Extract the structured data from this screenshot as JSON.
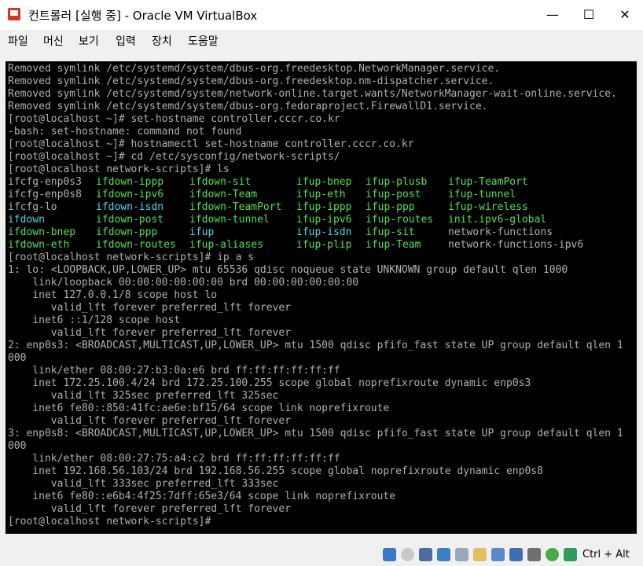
{
  "window": {
    "title": "컨트롤러 [실행 중] - Oracle VM VirtualBox",
    "minimize": "—",
    "maximize": "☐",
    "close": "✕"
  },
  "menu": [
    "파일",
    "머신",
    "보기",
    "입력",
    "장치",
    "도움말"
  ],
  "terminal": {
    "lines_before": [
      "Removed symlink /etc/systemd/system/dbus-org.freedesktop.NetworkManager.service.",
      "Removed symlink /etc/systemd/system/dbus-org.freedesktop.nm-dispatcher.service.",
      "Removed symlink /etc/systemd/system/network-online.target.wants/NetworkManager-wait-online.service.",
      "Removed symlink /etc/systemd/system/dbus-org.fedoraproject.FirewallD1.service.",
      "[root@localhost ~]# set-hostname controller.cccr.co.kr",
      "-bash: set-hostname: command not found",
      "[root@localhost ~]# hostnamectl set-hostname controller.cccr.co.kr",
      "[root@localhost ~]# cd /etc/sysconfig/network-scripts/",
      "[root@localhost network-scripts]# ls"
    ],
    "ls_rows": [
      [
        {
          "t": "ifcfg-enp0s3",
          "c": "gray"
        },
        {
          "t": "ifdown-ippp",
          "c": "green"
        },
        {
          "t": "ifdown-sit",
          "c": "green"
        },
        {
          "t": "ifup-bnep",
          "c": "green"
        },
        {
          "t": "ifup-plusb",
          "c": "green"
        },
        {
          "t": "ifup-TeamPort",
          "c": "green"
        }
      ],
      [
        {
          "t": "ifcfg-enp0s8",
          "c": "gray"
        },
        {
          "t": "ifdown-ipv6",
          "c": "green"
        },
        {
          "t": "ifdown-Team",
          "c": "green"
        },
        {
          "t": "ifup-eth",
          "c": "green"
        },
        {
          "t": "ifup-post",
          "c": "green"
        },
        {
          "t": "ifup-tunnel",
          "c": "green"
        }
      ],
      [
        {
          "t": "ifcfg-lo",
          "c": "gray"
        },
        {
          "t": "ifdown-isdn",
          "c": "cyan"
        },
        {
          "t": "ifdown-TeamPort",
          "c": "green"
        },
        {
          "t": "ifup-ippp",
          "c": "green"
        },
        {
          "t": "ifup-ppp",
          "c": "green"
        },
        {
          "t": "ifup-wireless",
          "c": "green"
        }
      ],
      [
        {
          "t": "ifdown",
          "c": "cyan"
        },
        {
          "t": "ifdown-post",
          "c": "green"
        },
        {
          "t": "ifdown-tunnel",
          "c": "green"
        },
        {
          "t": "ifup-ipv6",
          "c": "green"
        },
        {
          "t": "ifup-routes",
          "c": "green"
        },
        {
          "t": "init.ipv6-global",
          "c": "green"
        }
      ],
      [
        {
          "t": "ifdown-bnep",
          "c": "green"
        },
        {
          "t": "ifdown-ppp",
          "c": "green"
        },
        {
          "t": "ifup",
          "c": "cyan"
        },
        {
          "t": "ifup-isdn",
          "c": "cyan"
        },
        {
          "t": "ifup-sit",
          "c": "green"
        },
        {
          "t": "network-functions",
          "c": "gray"
        }
      ],
      [
        {
          "t": "ifdown-eth",
          "c": "green"
        },
        {
          "t": "ifdown-routes",
          "c": "green"
        },
        {
          "t": "ifup-aliases",
          "c": "green"
        },
        {
          "t": "ifup-plip",
          "c": "green"
        },
        {
          "t": "ifup-Team",
          "c": "green"
        },
        {
          "t": "network-functions-ipv6",
          "c": "gray"
        }
      ]
    ],
    "lines_after": [
      "[root@localhost network-scripts]# ip a s",
      "1: lo: <LOOPBACK,UP,LOWER_UP> mtu 65536 qdisc noqueue state UNKNOWN group default qlen 1000",
      "    link/loopback 00:00:00:00:00:00 brd 00:00:00:00:00:00",
      "    inet 127.0.0.1/8 scope host lo",
      "       valid_lft forever preferred_lft forever",
      "    inet6 ::1/128 scope host",
      "       valid_lft forever preferred_lft forever",
      "2: enp0s3: <BROADCAST,MULTICAST,UP,LOWER_UP> mtu 1500 qdisc pfifo_fast state UP group default qlen 1",
      "000",
      "    link/ether 08:00:27:b3:0a:e6 brd ff:ff:ff:ff:ff:ff",
      "    inet 172.25.100.4/24 brd 172.25.100.255 scope global noprefixroute dynamic enp0s3",
      "       valid_lft 325sec preferred_lft 325sec",
      "    inet6 fe80::850:41fc:ae6e:bf15/64 scope link noprefixroute",
      "       valid_lft forever preferred_lft forever",
      "3: enp0s8: <BROADCAST,MULTICAST,UP,LOWER_UP> mtu 1500 qdisc pfifo_fast state UP group default qlen 1",
      "000",
      "    link/ether 08:00:27:75:a4:c2 brd ff:ff:ff:ff:ff:ff",
      "    inet 192.168.56.103/24 brd 192.168.56.255 scope global noprefixroute dynamic enp0s8",
      "       valid_lft 333sec preferred_lft 333sec",
      "    inet6 fe80::e6b4:4f25:7dff:65e3/64 scope link noprefixroute",
      "       valid_lft forever preferred_lft forever",
      "[root@localhost network-scripts]#"
    ]
  },
  "statusbar": {
    "icons": [
      "hard-disk-icon",
      "optical-drive-icon",
      "audio-icon",
      "network-icon",
      "usb-icon",
      "shared-folder-icon",
      "display-icon",
      "video-capture-icon",
      "recording-icon",
      "cpu-icon",
      "mouse-integration-icon",
      "host-key-arrow-icon"
    ],
    "host_key": "Ctrl + Alt"
  },
  "colors": {
    "cyan": "#4fd6e6",
    "green": "#54e054",
    "gray": "#b0b0b0"
  }
}
